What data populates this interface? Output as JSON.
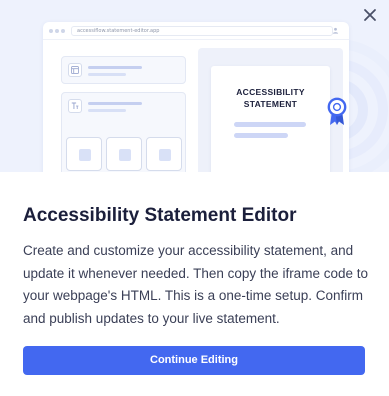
{
  "dialog": {
    "close_icon": "close-icon",
    "illustration": {
      "browser_url": "accessiflow.statement-editor.app",
      "doc_title_line1": "ACCESSIBILITY",
      "doc_title_line2": "STATEMENT",
      "badge_icon": "award-ribbon-icon",
      "text_format_icon": "text-format-icon",
      "layout_icon": "layout-icon",
      "user_icon": "user-icon"
    },
    "title": "Accessibility Statement Editor",
    "description": "Create and customize your accessibility statement, and update it whenever needed. Then copy the iframe code to your webpage's HTML. This is a one-time setup. Confirm and publish updates to your live statement.",
    "primary_button_label": "Continue Editing"
  },
  "colors": {
    "accent": "#4368f0",
    "hero_background": "#eef2fd",
    "title_text": "#1b1f3b",
    "body_text": "#3a3f56"
  }
}
